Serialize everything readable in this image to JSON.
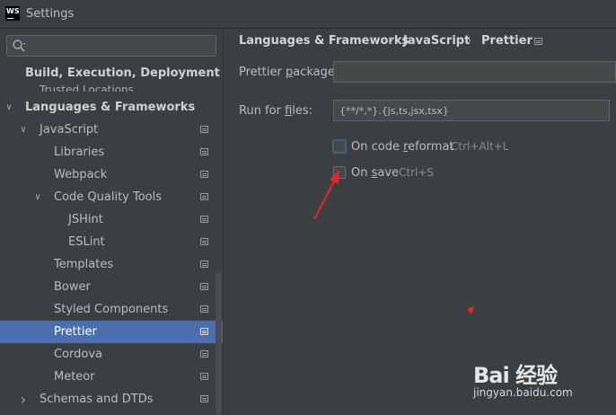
{
  "window": {
    "app_icon_text": "WS",
    "title": "Settings"
  },
  "sidebar": {
    "search": {
      "value": "",
      "placeholder": ""
    },
    "partial_item": "Trusted Locations",
    "items": [
      {
        "label": "Build, Execution, Deployment",
        "level": 0,
        "bold": true,
        "arrow": "",
        "icon": false
      },
      {
        "label": "Languages & Frameworks",
        "level": 0,
        "bold": true,
        "arrow": "expanded",
        "icon": false
      },
      {
        "label": "JavaScript",
        "level": 1,
        "bold": false,
        "arrow": "expanded",
        "icon": true
      },
      {
        "label": "Libraries",
        "level": 2,
        "bold": false,
        "arrow": "",
        "icon": true
      },
      {
        "label": "Webpack",
        "level": 2,
        "bold": false,
        "arrow": "",
        "icon": true
      },
      {
        "label": "Code Quality Tools",
        "level": 2,
        "bold": false,
        "arrow": "expanded",
        "icon": true
      },
      {
        "label": "JSHint",
        "level": 3,
        "bold": false,
        "arrow": "",
        "icon": true
      },
      {
        "label": "ESLint",
        "level": 3,
        "bold": false,
        "arrow": "",
        "icon": true
      },
      {
        "label": "Templates",
        "level": 2,
        "bold": false,
        "arrow": "",
        "icon": true
      },
      {
        "label": "Bower",
        "level": 2,
        "bold": false,
        "arrow": "",
        "icon": true
      },
      {
        "label": "Styled Components",
        "level": 2,
        "bold": false,
        "arrow": "",
        "icon": true
      },
      {
        "label": "Prettier",
        "level": 2,
        "bold": false,
        "arrow": "",
        "icon": true,
        "selected": true
      },
      {
        "label": "Cordova",
        "level": 2,
        "bold": false,
        "arrow": "",
        "icon": true
      },
      {
        "label": "Meteor",
        "level": 2,
        "bold": false,
        "arrow": "",
        "icon": true
      },
      {
        "label": "Schemas and DTDs",
        "level": 1,
        "bold": false,
        "arrow": "collapsed",
        "icon": true
      }
    ]
  },
  "breadcrumb": {
    "items": [
      "Languages & Frameworks",
      "JavaScript",
      "Prettier"
    ],
    "separator": "›"
  },
  "form": {
    "package_label_pre": "Prettier ",
    "package_label_u": "p",
    "package_label_post": "ackage:",
    "package_value": "",
    "files_label_pre": "Run for ",
    "files_label_u": "f",
    "files_label_post": "iles:",
    "files_value": "{**/*,*}.{js,ts,jsx,tsx}",
    "reformat": {
      "label_pre": "On code ",
      "label_u": "r",
      "label_post": "eformat",
      "shortcut": "Ctrl+Alt+L",
      "checked": false
    },
    "save": {
      "label_pre": "On ",
      "label_u": "s",
      "label_post": "ave",
      "shortcut": "Ctrl+S",
      "checked": false
    }
  },
  "watermark": {
    "logo": "Bai 经验",
    "url": "jingyan.baidu.com"
  },
  "colors": {
    "background": "#3c3f41",
    "selection": "#4b6eaf",
    "annotation_red": "#e8262a",
    "focus_ring": "#3d6185"
  }
}
